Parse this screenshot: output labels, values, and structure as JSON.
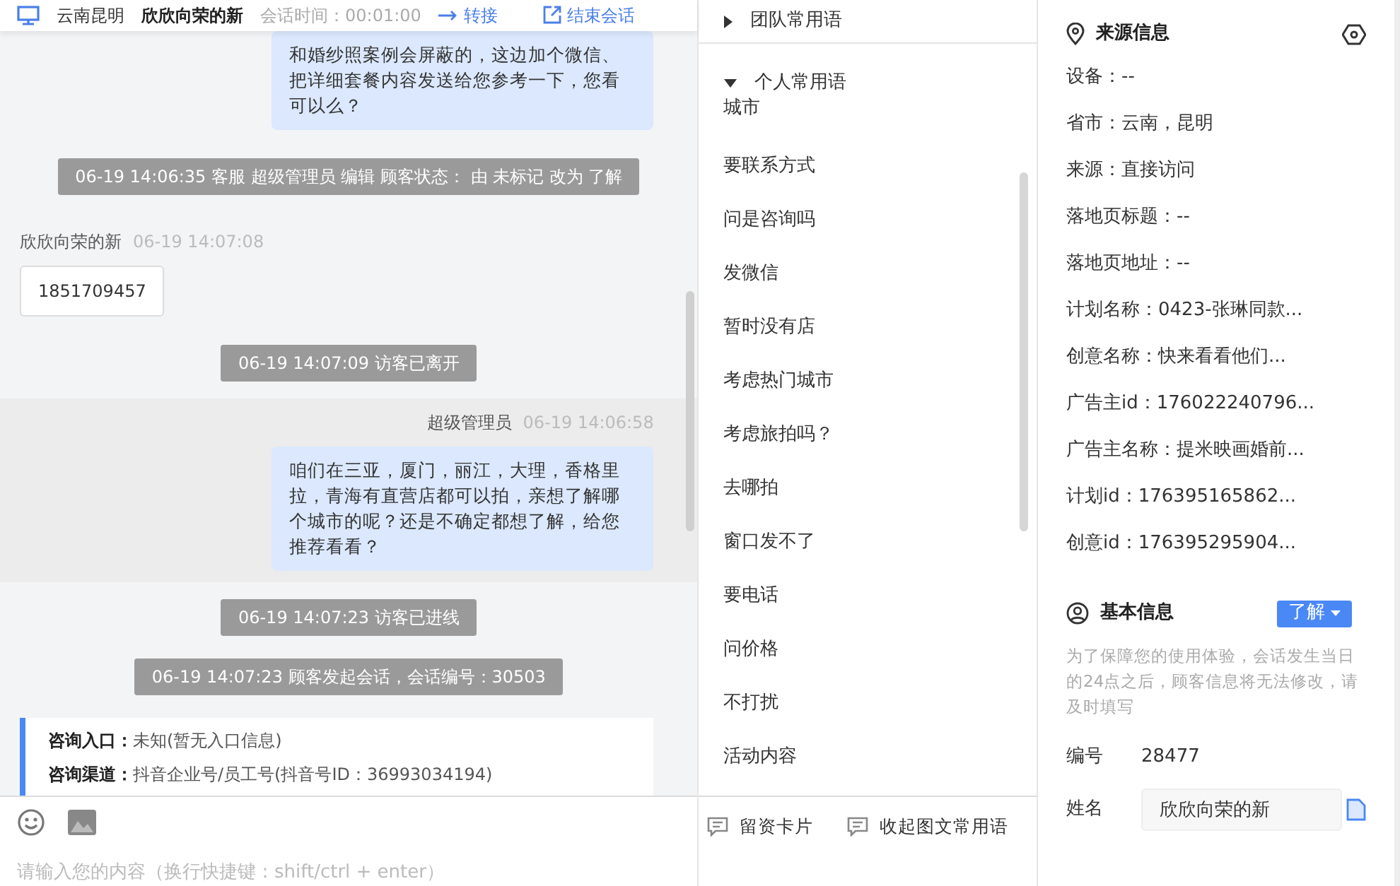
{
  "header": {
    "location": "云南昆明",
    "customer": "欣欣向荣的新",
    "duration": "会话时间：00:01:00",
    "transfer": "转接",
    "end": "结束会话"
  },
  "messages": [
    {
      "kind": "agent",
      "highlighted": false,
      "text": "和婚纱照案例会屏蔽的，这边加个微信、把详细套餐内容发送给您参考一下，您看可以么？"
    },
    {
      "kind": "system",
      "text": "06-19 14:06:35 客服 超级管理员 编辑 顾客状态： 由 未标记 改为 了解"
    },
    {
      "kind": "customer",
      "sender": "欣欣向荣的新",
      "time": "06-19 14:07:08",
      "text": "1851709457"
    },
    {
      "kind": "system",
      "text": "06-19 14:07:09 访客已离开"
    },
    {
      "kind": "agent",
      "highlighted": true,
      "sender": "超级管理员",
      "time": "06-19 14:06:58",
      "text": "咱们在三亚，厦门，丽江，大理，香格里拉，青海有直营店都可以拍，亲想了解哪个城市的呢？还是不确定都想了解，给您推荐看看？"
    },
    {
      "kind": "system",
      "text": "06-19 14:07:23 访客已进线"
    },
    {
      "kind": "system",
      "text": "06-19 14:07:23 顾客发起会话，会话编号：30503"
    },
    {
      "kind": "info",
      "rows": [
        {
          "label": "咨询入口：",
          "value": "未知(暂无入口信息)"
        },
        {
          "label": "咨询渠道：",
          "value": "抖音企业号/员工号(抖音号ID：36993034194)"
        }
      ]
    }
  ],
  "composer": {
    "placeholder": "请输入您的内容（换行快捷键：shift/ctrl + enter）"
  },
  "phrases": {
    "groups": [
      {
        "title": "团队常用语",
        "expanded": false
      },
      {
        "title": "个人常用语",
        "expanded": true,
        "items": [
          "城市",
          "要联系方式",
          "问是咨询吗",
          "发微信",
          "暂时没有店",
          "考虑热门城市",
          "考虑旅拍吗？",
          "去哪拍",
          "窗口发不了",
          "要电话",
          "问价格",
          "不打扰",
          "活动内容"
        ]
      }
    ],
    "actions": [
      "留资卡片",
      "收起图文常用语"
    ]
  },
  "source_info": {
    "title": "来源信息",
    "fields": [
      "设备：--",
      "省市：云南，昆明",
      "来源：直接访问",
      "落地页标题：--",
      "落地页地址：--",
      "计划名称：0423-张琳同款...",
      "创意名称：快来看看他们...",
      "广告主id：176022240796...",
      "广告主名称：提米映画婚前...",
      "计划id：176395165862...",
      "创意id：176395295904..."
    ]
  },
  "basic_info": {
    "title": "基本信息",
    "status": "了解",
    "notice": "为了保障您的使用体验，会话发生当日的24点之后，顾客信息将无法修改，请及时填写",
    "id_label": "编号",
    "id_value": "28477",
    "name_label": "姓名",
    "name_value": "欣欣向荣的新"
  }
}
